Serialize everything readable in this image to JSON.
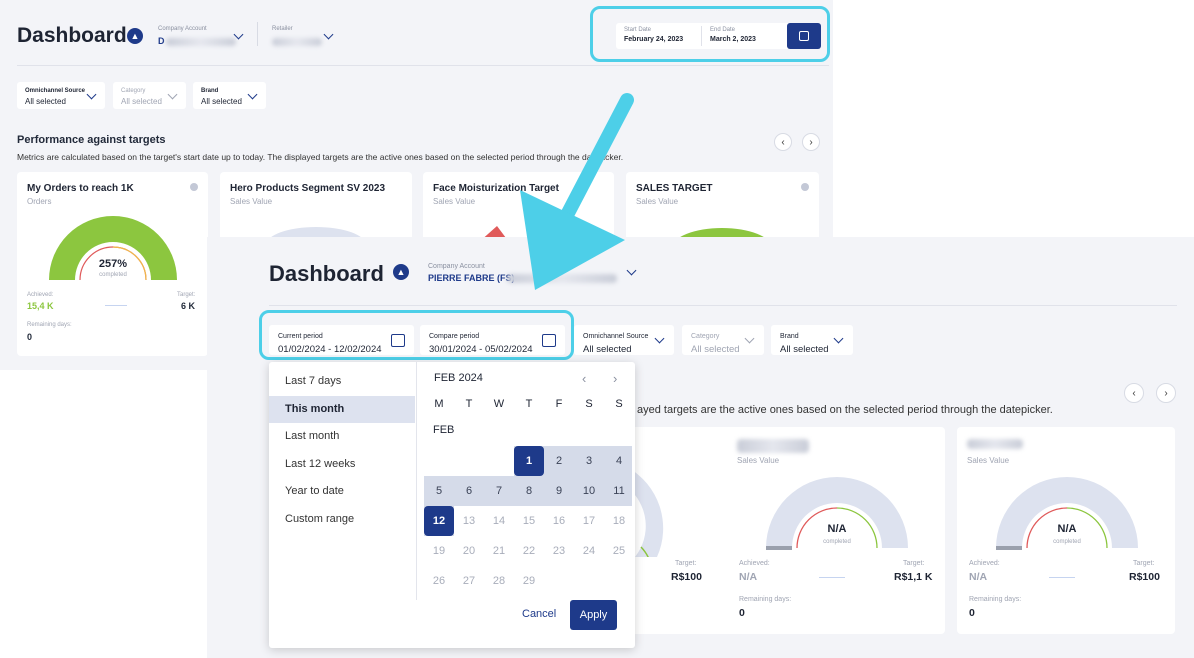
{
  "old": {
    "title": "Dashboard",
    "company_label": "Company Account",
    "company_value": "D",
    "retailer_label": "Retailer",
    "start_label": "Start Date",
    "start_value": "February 24, 2023",
    "end_label": "End Date",
    "end_value": "March 2, 2023",
    "filters": [
      {
        "label": "Omnichannel Source",
        "value": "All selected"
      },
      {
        "label": "Category",
        "value": "All selected"
      },
      {
        "label": "Brand",
        "value": "All selected"
      }
    ],
    "perf_title": "Performance against targets",
    "perf_sub": "Metrics are calculated based on the target's start date up to today. The displayed targets are the active ones based on the selected period through the datepicker.",
    "cards": [
      {
        "title": "My Orders to reach 1K",
        "sub": "Orders",
        "percent": "257%",
        "completed": "completed",
        "achieved_label": "Achieved:",
        "achieved": "15,4 K",
        "target_label": "Target:",
        "target": "6 K",
        "remaining_label": "Remaining days:",
        "remaining": "0"
      },
      {
        "title": "Hero Products Segment SV 2023",
        "sub": "Sales Value"
      },
      {
        "title": "Face Moisturization Target",
        "sub": "Sales Value"
      },
      {
        "title": "SALES TARGET",
        "sub": "Sales Value"
      }
    ]
  },
  "new": {
    "title": "Dashboard",
    "company_label": "Company Account",
    "company_value": "PIERRE FABRE (FS)",
    "current_label": "Current period",
    "current_value": "01/02/2024 - 12/02/2024",
    "compare_label": "Compare period",
    "compare_value": "30/01/2024 - 05/02/2024",
    "filters": [
      {
        "label": "Omnichannel Source",
        "value": "All selected"
      },
      {
        "label": "Category",
        "value": "All selected"
      },
      {
        "label": "Brand",
        "value": "All selected"
      }
    ],
    "sub_fragment": "ayed targets are the active ones based on the selected period through the datepicker.",
    "cards": [
      {
        "target_label": "Target:",
        "target": "R$100"
      },
      {
        "sub": "Sales Value",
        "na": "N/A",
        "completed": "completed",
        "achieved_label": "Achieved:",
        "achieved": "N/A",
        "target_label": "Target:",
        "target": "R$1,1 K",
        "remaining_label": "Remaining days:",
        "remaining": "0"
      },
      {
        "sub": "Sales Value",
        "na": "N/A",
        "completed": "completed",
        "achieved_label": "Achieved:",
        "achieved": "N/A",
        "target_label": "Target:",
        "target": "R$100",
        "remaining_label": "Remaining days:",
        "remaining": "0"
      }
    ]
  },
  "datepicker": {
    "presets": [
      "Last 7 days",
      "This month",
      "Last month",
      "Last 12 weeks",
      "Year to date",
      "Custom range"
    ],
    "active_preset": "This month",
    "month_title": "FEB 2024",
    "weekdays": [
      "M",
      "T",
      "W",
      "T",
      "F",
      "S",
      "S"
    ],
    "month_short": "FEB",
    "cancel": "Cancel",
    "apply": "Apply"
  },
  "colors": {
    "accent": "#1e3a8a",
    "highlight": "#4dcfe8",
    "green": "#8cc63f",
    "red": "#e05a5a"
  }
}
